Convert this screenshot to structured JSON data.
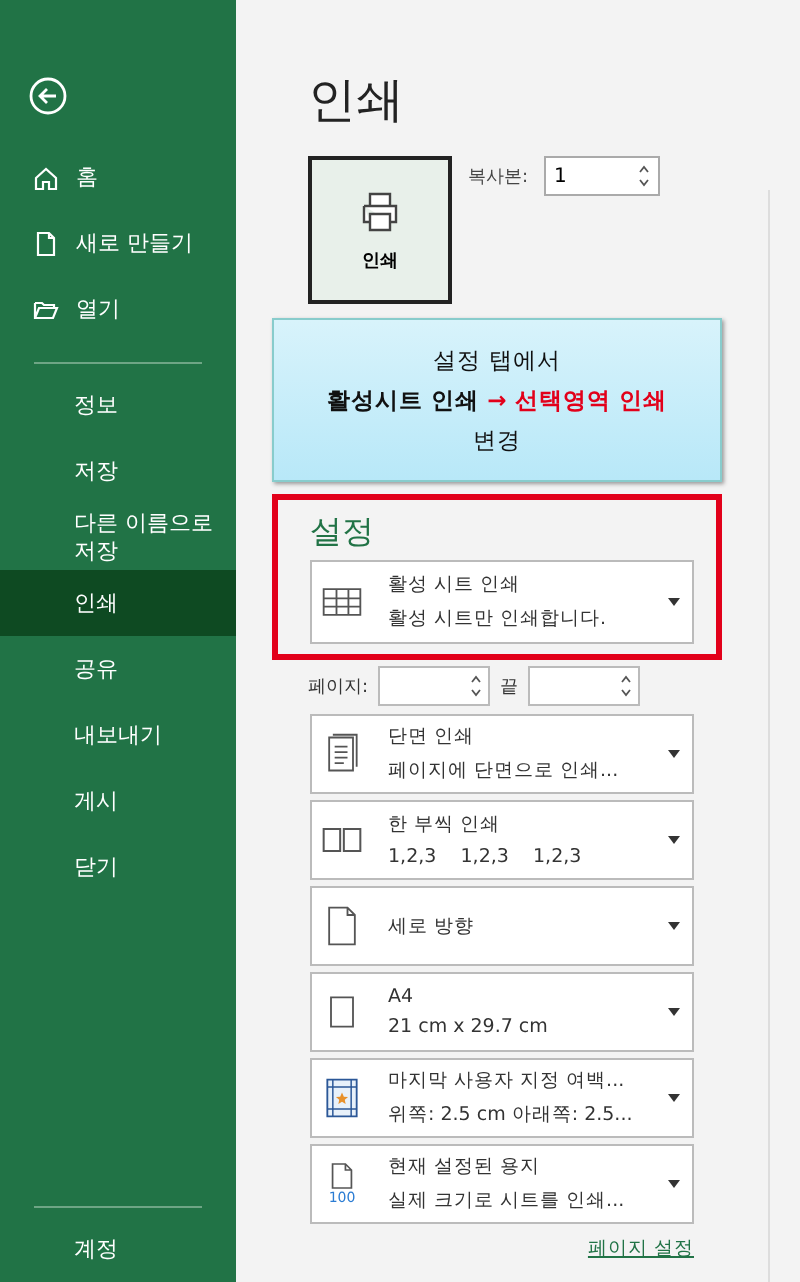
{
  "sidebar": {
    "top_items": [
      {
        "kind": "home",
        "label": "홈"
      },
      {
        "kind": "new",
        "label": "새로 만들기"
      },
      {
        "kind": "open",
        "label": "열기"
      }
    ],
    "items": [
      {
        "label": "정보",
        "selected": false
      },
      {
        "label": "저장",
        "selected": false
      },
      {
        "label": "다른 이름으로 저장",
        "selected": false
      },
      {
        "label": "인쇄",
        "selected": true
      },
      {
        "label": "공유",
        "selected": false
      },
      {
        "label": "내보내기",
        "selected": false
      },
      {
        "label": "게시",
        "selected": false
      },
      {
        "label": "닫기",
        "selected": false
      }
    ],
    "bottom_items": [
      {
        "label": "계정",
        "selected": false
      }
    ]
  },
  "title": "인쇄",
  "print_button": "인쇄",
  "copies": {
    "label": "복사본:",
    "value": "1"
  },
  "callout": {
    "line1": "설정 탭에서",
    "from": "활성시트 인쇄",
    "to": "→ 선택영역 인쇄",
    "line3": "변경"
  },
  "settings_title": "설정",
  "selection": {
    "kind": "sheet",
    "title": "활성 시트 인쇄",
    "subtitle": "활성 시트만 인쇄합니다."
  },
  "pages": {
    "label": "페이지:",
    "to_label": "끝"
  },
  "options": [
    {
      "kind": "duplex",
      "title": "단면 인쇄",
      "subtitle": "페이지에 단면으로 인쇄..."
    },
    {
      "kind": "collate",
      "title": "한 부씩 인쇄",
      "subtitle": "1,2,3    1,2,3    1,2,3"
    },
    {
      "kind": "portrait",
      "title": "세로 방향"
    },
    {
      "kind": "paper",
      "title": "A4",
      "subtitle": "21 cm x 29.7 cm"
    },
    {
      "kind": "margins",
      "title": "마지막 사용자 지정 여백...",
      "subtitle": "위쪽: 2.5 cm 아래쪽: 2.5..."
    },
    {
      "kind": "scale",
      "title": "현재 설정된 용지",
      "subtitle": "실제 크기로 시트를 인쇄...",
      "badge": "100"
    }
  ],
  "page_setup_link": "페이지 설정"
}
